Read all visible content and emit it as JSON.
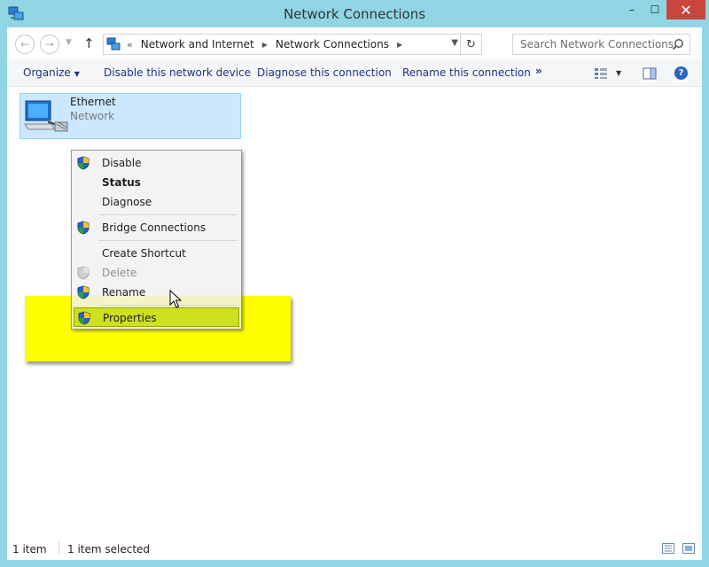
{
  "window": {
    "title": "Network Connections",
    "controls": {
      "minimize": "–",
      "maximize": "☐",
      "close": "✕"
    }
  },
  "navigation": {
    "back_icon": "arrow-left-icon",
    "forward_icon": "arrow-right-icon",
    "up_icon": "arrow-up-icon",
    "breadcrumb": [
      "Network and Internet",
      "Network Connections"
    ],
    "search_placeholder": "Search Network Connections"
  },
  "commands": {
    "organize": "Organize",
    "disable": "Disable this network device",
    "diagnose": "Diagnose this connection",
    "rename": "Rename this connection",
    "more": "»"
  },
  "item": {
    "name": "Ethernet",
    "subtitle": "Network",
    "selected": true
  },
  "context_menu": {
    "items": [
      {
        "label": "Disable",
        "icon": "uac-shield-icon"
      },
      {
        "label": "Status",
        "bold": true
      },
      {
        "label": "Diagnose"
      },
      {
        "label": "Bridge Connections",
        "icon": "uac-shield-icon"
      },
      {
        "label": "Create Shortcut"
      },
      {
        "label": "Delete",
        "icon": "uac-shield-icon",
        "disabled": true
      },
      {
        "label": "Rename",
        "icon": "uac-shield-icon"
      },
      {
        "label": "Properties",
        "icon": "uac-shield-icon",
        "highlighted": true
      }
    ]
  },
  "statusbar": {
    "item_count": "1 item",
    "selected_count": "1 item selected"
  },
  "colors": {
    "titlebar": "#8fd5e4",
    "close_button": "#c9463d",
    "selection": "#cce8ff",
    "highlight_box": "#ffff00",
    "link_text": "#1e3287"
  }
}
